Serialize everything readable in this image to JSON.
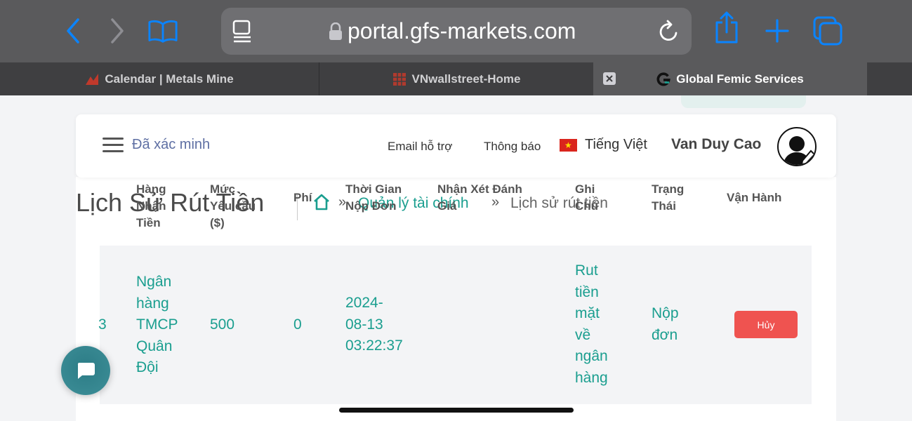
{
  "browser": {
    "url": "portal.gfs-markets.com",
    "tabs": [
      {
        "title": "Calendar | Metals Mine",
        "active": false
      },
      {
        "title": "VNwallstreet-Home",
        "active": false
      },
      {
        "title": "Global Femic Services",
        "active": true
      }
    ],
    "icons": [
      "back-icon",
      "forward-icon",
      "bookmarks-icon",
      "reader-icon",
      "lock-icon",
      "reload-icon",
      "share-icon",
      "new-tab-icon",
      "tabs-icon"
    ]
  },
  "header": {
    "status": "Đã xác minh",
    "support_email": "Email hỗ trợ",
    "notifications": "Thông báo",
    "language": "Tiếng Việt",
    "user_name": "Van Duy Cao"
  },
  "page": {
    "title": "Lịch Sử Rút Tiền",
    "breadcrumb": {
      "separator": "»",
      "parent": "Quản lý tài chính",
      "current": "Lịch sử rút tiền"
    }
  },
  "table": {
    "headers": {
      "bank": "Hàng\nNhận\nTiền",
      "amount": "Mức\nYêu cầu\n($)",
      "fee": "Phí",
      "time": "Thời Gian\nNộp Đơn",
      "review": "Nhận Xét Đánh\nGiá",
      "note": "Ghi\nChú",
      "status": "Trạng\nThái",
      "action": "Vận Hành"
    },
    "rows": [
      {
        "id": "3",
        "bank": "Ngân\nhàng\nTMCP\nQuân\nĐội",
        "amount": "500",
        "fee": "0",
        "time": "2024-\n08-13\n03:22:37",
        "review": "",
        "note": "Rut\ntiền\nmặt\nvề\nngân\nhàng",
        "status": "Nộp\nđơn",
        "action_label": "Hủy"
      }
    ]
  },
  "colors": {
    "accent": "#1a9e8f",
    "danger": "#ef5350",
    "toolbar": "#5a5a5c",
    "link_blue": "#0a84ff"
  }
}
